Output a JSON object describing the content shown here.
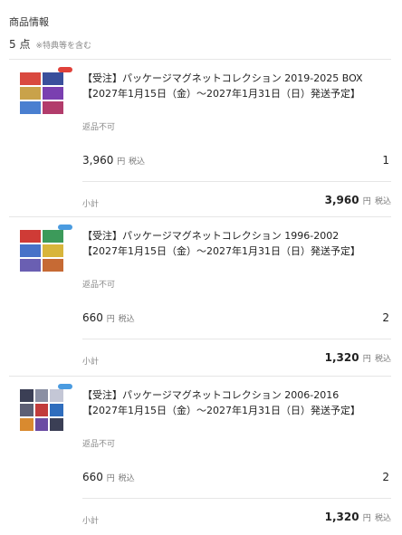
{
  "header": {
    "title": "商品情報",
    "count": "5 点",
    "note": "※特典等を含む"
  },
  "labels": {
    "non_returnable": "返品不可",
    "yen": "円",
    "tax_included": "税込",
    "subtotal": "小計"
  },
  "items": [
    {
      "title_line1": "【受注】パッケージマグネットコレクション 2019-2025 BOX",
      "title_line2": "【2027年1月15日（金）～2027年1月31日（日）発送予定】",
      "price": "3,960",
      "qty": "1",
      "subtotal": "3,960",
      "badge_color": "#e0413a",
      "thumb_colors": [
        "#d9493f",
        "#3a4f9c",
        "#c9a24a",
        "#7a3fb0",
        "#4a7fd0",
        "#b23c6b",
        "#8c8fc7",
        "#d77a3a"
      ]
    },
    {
      "title_line1": "【受注】パッケージマグネットコレクション 1996-2002",
      "title_line2": "【2027年1月15日（金）～2027年1月31日（日）発送予定】",
      "price": "660",
      "qty": "2",
      "subtotal": "1,320",
      "badge_color": "#4a9be0",
      "thumb_colors": [
        "#cf3b36",
        "#3c9a5a",
        "#4772c8",
        "#d8b53b",
        "#6a5fb2",
        "#c66a34",
        "#3e8fb8",
        "#9b3a8e"
      ]
    },
    {
      "title_line1": "【受注】パッケージマグネットコレクション 2006-2016",
      "title_line2": "【2027年1月15日（金）～2027年1月31日（日）発送予定】",
      "price": "660",
      "qty": "2",
      "subtotal": "1,320",
      "badge_color": "#4a9be0",
      "thumb_colors": [
        "#3b3f55",
        "#8a8fa3",
        "#c4c7d6",
        "#5d5f74",
        "#c23b3b",
        "#2f6dbd",
        "#d98a2f",
        "#6b4ca3"
      ]
    }
  ]
}
